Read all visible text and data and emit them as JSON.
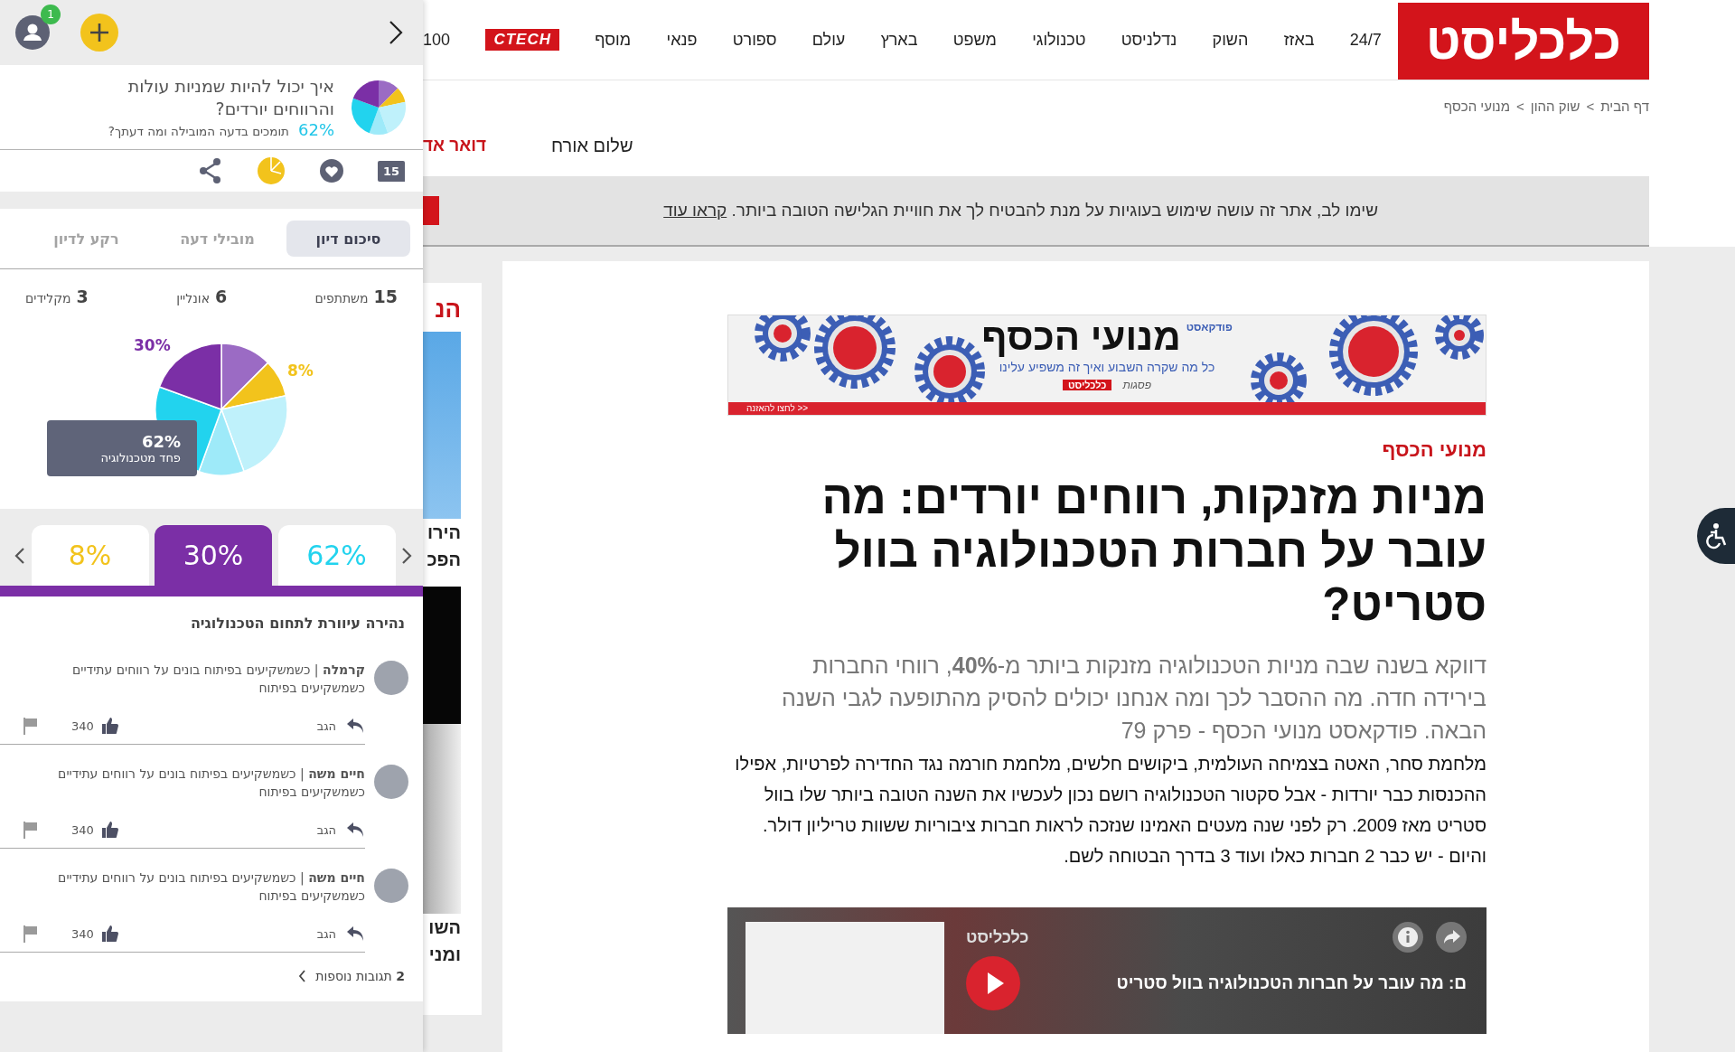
{
  "panel": {
    "notifications": "1",
    "question": {
      "text": "איך יכול להיות שמניות עולות והרווחים יורדים?",
      "percent": "62%",
      "prompt": "תומכים בדעה המובילה ומה דעתך?"
    },
    "comment_count": "15",
    "tabs": [
      {
        "label": "סיכום דיון",
        "selected": true
      },
      {
        "label": "מובילי דעה",
        "selected": false
      },
      {
        "label": "רקע לדיון",
        "selected": false
      }
    ],
    "stats": [
      {
        "value": "15",
        "label": "משתתפים"
      },
      {
        "value": "6",
        "label": "אונליין"
      },
      {
        "value": "3",
        "label": "מקלידים"
      }
    ],
    "pie_labels": [
      {
        "text": "30%",
        "color": "#7b2fa6"
      },
      {
        "text": "8%",
        "color": "#f2c31c"
      }
    ],
    "tooltip": {
      "value": "62%",
      "label": "פחד מטכנולוגיה"
    },
    "groups": [
      {
        "value": "62%",
        "color": "#22d3ee",
        "selected": false
      },
      {
        "value": "30%",
        "color": "#7b2fa6",
        "selected": true
      },
      {
        "value": "8%",
        "color": "#f2c31c",
        "selected": false
      }
    ],
    "group_title": "נהירה עיוורת לתחום הטכנולוגיה",
    "comments": [
      {
        "text": "**קרמלה** | כשמשקיעים בפיתוח בונים על רווחים עתידיים כשמשקיעים בפיתוח",
        "reply": "הגב",
        "likes": "340"
      },
      {
        "text": "**חיים משה** | כשמשקיעים בפיתוח בונים על רווחים עתידיים כשמשקיעים בפיתוח",
        "reply": "הגב",
        "likes": "340"
      },
      {
        "text": "**חיים משה** | כשמשקיעים בפיתוח בונים על רווחים עתידיים כשמשקיעים בפיתוח",
        "reply": "הגב",
        "likes": "340"
      }
    ],
    "more": {
      "count": "2",
      "label": "תגובות נוספות"
    }
  },
  "header": {
    "logo": "כלכליסט",
    "nav": [
      {
        "label": "24/7",
        "kind": "link"
      },
      {
        "label": "באזז",
        "kind": "link"
      },
      {
        "label": "השוק",
        "kind": "link"
      },
      {
        "label": "נדלניסט",
        "kind": "link"
      },
      {
        "label": "טכנולוגי",
        "kind": "link"
      },
      {
        "label": "משפט",
        "kind": "link"
      },
      {
        "label": "בארץ",
        "kind": "link"
      },
      {
        "label": "עולם",
        "kind": "link"
      },
      {
        "label": "ספורט",
        "kind": "link"
      },
      {
        "label": "פנאי",
        "kind": "link"
      },
      {
        "label": "מוסף",
        "kind": "link"
      },
      {
        "label": "CTECH",
        "kind": "badge"
      },
      {
        "label": "100",
        "kind": "link"
      }
    ],
    "breadcrumb": {
      "items": [
        "דף הבית",
        "שוק ההון",
        "מנועי הכסף"
      ],
      "separator": ">"
    },
    "greeting": "שלום אורח",
    "mail": "דואר אד",
    "cookie": {
      "text": "שימו לב, אתר זה עושה שימוש בעוגיות על מנת להבטיח לך את חוויית הגלישה הטובה ביותר.",
      "link": "קראו עוד"
    }
  },
  "sidebar": {
    "heading": "הנ",
    "captions": [
      [
        "הירו",
        "הפכ"
      ],
      [
        "השו",
        "ומני"
      ]
    ]
  },
  "article": {
    "banner": {
      "kicker": "פודקאסט",
      "title": "מנועי הכסף",
      "subtitle": "כל מה שקרה השבוע ואיך זה משפיע עלינו",
      "brand": "כלכליסט",
      "sponsor": "פסגות",
      "cta": "לחצו להאזנה >>"
    },
    "category": "מנועי הכסף",
    "title": "מניות מזנקות, רווחים יורדים: מה עובר על חברות הטכנולוגיה בוול סטריט?",
    "subtitle": "דווקא בשנה שבה מניות הטכנולוגיה מזנקות ביותר מ-**40%**, רווחי החברות בירידה חדה. מה ההסבר לכך ומה אנחנו יכולים להסיק מהתופעה לגבי השנה הבאה. פודקאסט מנועי הכסף - פרק 79",
    "body": "מלחמת סחר, האטה בצמיחה העולמית, ביקושים חלשים, מלחמת חורמה נגד החדירה לפרטיות, אפילו ההכנסות כבר יורדות - אבל סקטור הטכנולוגיה רושם נכון לעכשיו את השנה הטובה ביותר שלו בוול סטריט מאז 2009. רק לפני שנה מעטים האמינו שנזכה לראות חברות ציבוריות ששוות טריליון דולר. והיום - יש כבר 2 חברות כאלו ועוד 3 בדרך הבטוחה לשם.",
    "player": {
      "channel": "כלכליסט",
      "title": "ם: מה עובר על חברות הטכנולוגיה בוול סטריט"
    }
  }
}
